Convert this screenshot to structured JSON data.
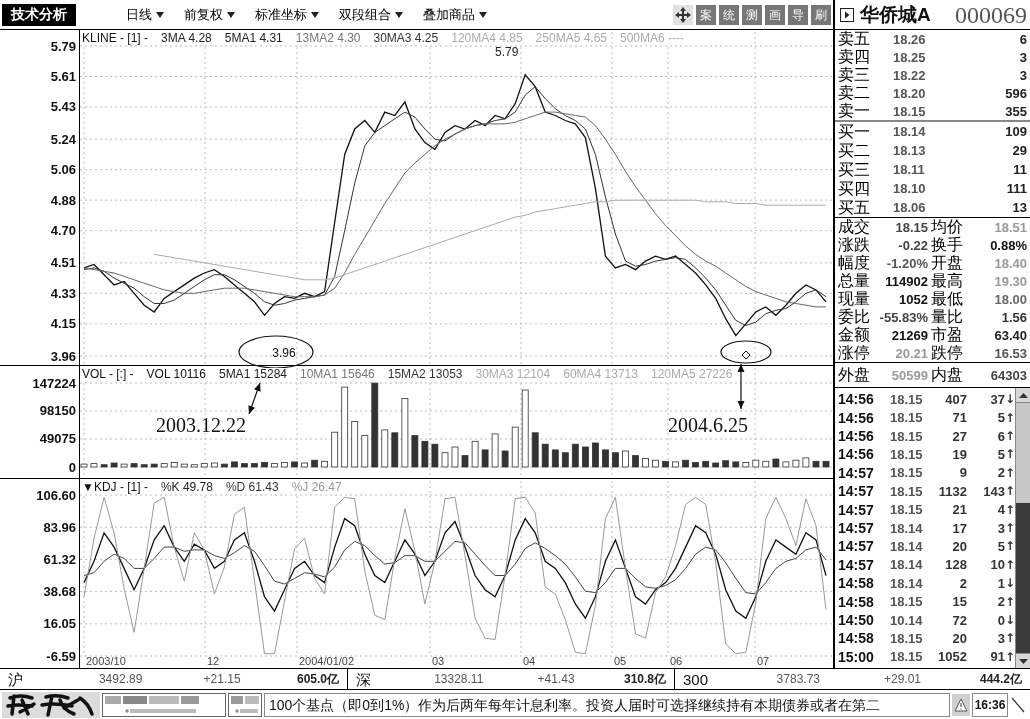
{
  "toolbar": {
    "title": "技术分析",
    "menus": [
      "日线",
      "前复权",
      "标准坐标",
      "双段组合",
      "叠加商品"
    ],
    "tools": [
      "案",
      "统",
      "测",
      "画",
      "导",
      "刷"
    ]
  },
  "quote_header": {
    "name": "华侨城A",
    "code": "000069"
  },
  "price_panel": {
    "legend": [
      {
        "text": "KLINE - [1] -",
        "color": "#111111"
      },
      {
        "text": "3MA 4.28",
        "color": "#222222"
      },
      {
        "text": "5MA1 4.31",
        "color": "#222222"
      },
      {
        "text": "13MA2 4.30",
        "color": "#777777"
      },
      {
        "text": "30MA3 4.25",
        "color": "#333333"
      },
      {
        "text": "120MA4 4.85",
        "color": "#aaaaaa"
      },
      {
        "text": "250MA5 4.65",
        "color": "#aaaaaa"
      },
      {
        "text": "500MA6 ----",
        "color": "#aaaaaa"
      }
    ],
    "chart_data": {
      "type": "line",
      "grid": true,
      "ylim": [
        3.96,
        5.79
      ],
      "yticks": [
        5.79,
        5.61,
        5.43,
        5.24,
        5.06,
        4.88,
        {
          "value": 4.7,
          "label": "4.70"
        },
        4.51,
        4.33,
        4.15,
        3.96
      ],
      "series": [
        {
          "color": "#111111",
          "values": [
            4.48,
            4.5,
            4.44,
            4.38,
            4.4,
            4.33,
            4.26,
            4.22,
            4.3,
            4.34,
            4.38,
            4.42,
            4.45,
            4.47,
            4.43,
            4.38,
            4.33,
            4.28,
            4.2,
            4.27,
            4.31,
            4.3,
            4.33,
            4.31,
            4.34,
            4.75,
            5.15,
            5.3,
            5.35,
            5.28,
            5.4,
            5.38,
            5.46,
            5.3,
            5.22,
            5.18,
            5.28,
            5.32,
            5.3,
            5.35,
            5.32,
            5.38,
            5.36,
            5.45,
            5.62,
            5.55,
            5.4,
            5.38,
            5.35,
            5.33,
            5.25,
            4.95,
            4.55,
            4.48,
            4.5,
            4.47,
            4.52,
            4.55,
            4.53,
            4.55,
            4.5,
            4.45,
            4.38,
            4.3,
            4.18,
            4.08,
            4.15,
            4.22,
            4.25,
            4.2,
            4.26,
            4.33,
            4.38,
            4.35,
            4.28
          ]
        },
        {
          "color": "#333333",
          "values": [
            4.47,
            4.48,
            4.46,
            4.42,
            4.39,
            4.36,
            4.31,
            4.27,
            4.27,
            4.29,
            4.33,
            4.37,
            4.41,
            4.44,
            4.44,
            4.41,
            4.37,
            4.33,
            4.28,
            4.26,
            4.27,
            4.29,
            4.3,
            4.31,
            4.32,
            4.43,
            4.7,
            4.98,
            5.2,
            5.28,
            5.32,
            5.36,
            5.4,
            5.37,
            5.3,
            5.24,
            5.23,
            5.27,
            5.3,
            5.32,
            5.33,
            5.35,
            5.36,
            5.4,
            5.5,
            5.55,
            5.48,
            5.42,
            5.38,
            5.35,
            5.3,
            5.15,
            4.9,
            4.68,
            4.52,
            4.49,
            4.5,
            4.52,
            4.53,
            4.54,
            4.53,
            4.48,
            4.42,
            4.35,
            4.26,
            4.17,
            4.14,
            4.16,
            4.21,
            4.23,
            4.24,
            4.28,
            4.33,
            4.35,
            4.31
          ]
        },
        {
          "color": "#666666",
          "values": [
            4.48,
            4.47,
            4.46,
            4.45,
            4.43,
            4.41,
            4.39,
            4.37,
            4.35,
            4.34,
            4.33,
            4.33,
            4.34,
            4.35,
            4.36,
            4.36,
            4.36,
            4.35,
            4.34,
            4.33,
            4.32,
            4.31,
            4.31,
            4.31,
            4.32,
            4.36,
            4.45,
            4.56,
            4.66,
            4.76,
            4.86,
            4.95,
            5.04,
            5.1,
            5.15,
            5.2,
            5.24,
            5.27,
            5.3,
            5.32,
            5.33,
            5.33,
            5.33,
            5.34,
            5.36,
            5.38,
            5.4,
            5.4,
            5.39,
            5.38,
            5.37,
            5.32,
            5.24,
            5.15,
            5.05,
            4.96,
            4.88,
            4.8,
            4.73,
            4.67,
            4.61,
            4.56,
            4.52,
            4.49,
            4.45,
            4.41,
            4.37,
            4.34,
            4.32,
            4.3,
            4.28,
            4.27,
            4.26,
            4.25,
            4.25
          ]
        },
        {
          "color": "#aaaaaa",
          "values": [
            null,
            null,
            null,
            null,
            null,
            null,
            null,
            4.56,
            4.55,
            4.54,
            4.53,
            4.52,
            4.51,
            4.5,
            4.49,
            4.48,
            4.47,
            4.46,
            4.45,
            4.44,
            4.43,
            4.42,
            4.41,
            4.41,
            4.41,
            4.42,
            4.44,
            4.46,
            4.48,
            4.5,
            4.52,
            4.54,
            4.56,
            4.58,
            4.6,
            4.62,
            4.64,
            4.66,
            4.68,
            4.7,
            4.72,
            4.74,
            4.76,
            4.78,
            4.79,
            4.81,
            4.82,
            4.83,
            4.84,
            4.85,
            4.86,
            4.87,
            4.87,
            4.88,
            4.88,
            4.88,
            4.88,
            4.88,
            4.88,
            4.88,
            4.88,
            4.88,
            4.87,
            4.87,
            4.87,
            4.86,
            4.86,
            4.86,
            4.85,
            4.85,
            4.85,
            4.85,
            4.85,
            4.85,
            4.85
          ]
        }
      ]
    },
    "peak_label": "5.79",
    "callouts": [
      {
        "kind": "text",
        "text": "3.96",
        "date": "2003.12.22"
      },
      {
        "kind": "marker",
        "date": "2004.6.25"
      }
    ]
  },
  "volume_panel": {
    "legend": [
      {
        "text": "VOL - [:] -",
        "color": "#111111"
      },
      {
        "text": "VOL 10116",
        "color": "#111111"
      },
      {
        "text": "5MA1 15284",
        "color": "#222222"
      },
      {
        "text": "10MA1 15646",
        "color": "#777777"
      },
      {
        "text": "15MA2 13053",
        "color": "#333333"
      },
      {
        "text": "30MA3 12104",
        "color": "#aaaaaa"
      },
      {
        "text": "60MA4 13713",
        "color": "#aaaaaa"
      },
      {
        "text": "120MA5 27226",
        "color": "#aaaaaa"
      }
    ],
    "chart_data": {
      "type": "bar",
      "grid": true,
      "ylim": [
        0,
        147224
      ],
      "yticks": [
        147224,
        98150,
        49075,
        0
      ],
      "values": [
        5000,
        6000,
        4000,
        7000,
        5000,
        6000,
        4000,
        5000,
        6000,
        8000,
        5000,
        4000,
        6000,
        7000,
        5000,
        9000,
        6000,
        6000,
        8000,
        6000,
        8000,
        9000,
        7000,
        12000,
        10000,
        61000,
        140000,
        80000,
        55000,
        147000,
        65000,
        60000,
        120000,
        55000,
        45000,
        40000,
        25000,
        35000,
        20000,
        45000,
        30000,
        58000,
        28000,
        70000,
        135000,
        60000,
        40000,
        30000,
        25000,
        40000,
        35000,
        42000,
        30000,
        25000,
        28000,
        20000,
        15000,
        12000,
        10000,
        9000,
        12000,
        8000,
        10000,
        7000,
        11000,
        9000,
        8000,
        12000,
        10000,
        14000,
        9000,
        12000,
        16000,
        10000,
        10000
      ]
    }
  },
  "kdj_panel": {
    "legend": [
      {
        "text": "▼KDJ - [1] -",
        "color": "#111111"
      },
      {
        "text": "%K 49.78",
        "color": "#222222"
      },
      {
        "text": "%D 61.43",
        "color": "#333333"
      },
      {
        "text": "%J 26.47",
        "color": "#999999"
      }
    ],
    "chart_data": {
      "type": "line",
      "grid": true,
      "ylim": [
        -6.59,
        106.6
      ],
      "yticks": [
        {
          "value": 106.6,
          "label": "106.60"
        },
        83.96,
        61.32,
        38.68,
        16.05,
        -6.59
      ],
      "series": [
        {
          "color": "#111111",
          "values": [
            45,
            60,
            80,
            70,
            55,
            40,
            55,
            75,
            85,
            70,
            60,
            72,
            68,
            55,
            60,
            75,
            80,
            60,
            35,
            25,
            40,
            55,
            60,
            50,
            45,
            70,
            90,
            85,
            65,
            50,
            45,
            60,
            75,
            65,
            50,
            60,
            80,
            88,
            70,
            50,
            40,
            35,
            50,
            75,
            90,
            80,
            60,
            55,
            45,
            30,
            20,
            35,
            60,
            75,
            55,
            35,
            30,
            40,
            45,
            55,
            70,
            85,
            80,
            65,
            40,
            25,
            20,
            35,
            60,
            75,
            70,
            65,
            80,
            75,
            50
          ]
        },
        {
          "color": "#444444",
          "values": [
            50,
            52,
            60,
            65,
            62,
            55,
            55,
            62,
            70,
            70,
            67,
            68,
            68,
            64,
            62,
            66,
            71,
            67,
            57,
            46,
            44,
            48,
            52,
            51,
            49,
            56,
            68,
            74,
            71,
            64,
            58,
            59,
            64,
            64,
            60,
            60,
            67,
            74,
            73,
            65,
            57,
            50,
            50,
            58,
            69,
            73,
            69,
            64,
            58,
            49,
            39,
            38,
            45,
            55,
            55,
            48,
            42,
            41,
            43,
            47,
            55,
            65,
            70,
            68,
            59,
            48,
            38,
            37,
            45,
            55,
            60,
            62,
            68,
            70,
            61
          ]
        },
        {
          "color": "#999999",
          "values": [
            35,
            76,
            105,
            80,
            41,
            10,
            55,
            101,
            105,
            70,
            46,
            80,
            68,
            37,
            56,
            93,
            98,
            46,
            -5,
            -5,
            32,
            69,
            76,
            48,
            37,
            98,
            105,
            104,
            53,
            22,
            19,
            62,
            97,
            67,
            30,
            60,
            104,
            105,
            64,
            20,
            6,
            5,
            50,
            104,
            105,
            94,
            42,
            37,
            19,
            -4,
            -5,
            29,
            90,
            105,
            55,
            9,
            6,
            38,
            49,
            71,
            100,
            105,
            100,
            59,
            2,
            -5,
            -4,
            31,
            90,
            105,
            90,
            71,
            104,
            85,
            26
          ]
        }
      ]
    }
  },
  "date_axis": [
    "2003/10",
    "12",
    "2004/01/02",
    "03",
    "04",
    "05",
    "06",
    "07"
  ],
  "order_book": {
    "asks": [
      {
        "label": "卖五",
        "price": "18.26",
        "volume": "6"
      },
      {
        "label": "卖四",
        "price": "18.25",
        "volume": "3"
      },
      {
        "label": "卖三",
        "price": "18.22",
        "volume": "3"
      },
      {
        "label": "卖二",
        "price": "18.20",
        "volume": "596"
      },
      {
        "label": "卖一",
        "price": "18.15",
        "volume": "355"
      }
    ],
    "bids": [
      {
        "label": "买一",
        "price": "18.14",
        "volume": "109"
      },
      {
        "label": "买二",
        "price": "18.13",
        "volume": "29"
      },
      {
        "label": "买三",
        "price": "18.11",
        "volume": "11"
      },
      {
        "label": "买四",
        "price": "18.10",
        "volume": "111"
      },
      {
        "label": "买五",
        "price": "18.06",
        "volume": "13"
      }
    ]
  },
  "stats": [
    {
      "left": {
        "label": "成交",
        "value": "18.15",
        "color": "#444444"
      },
      "right": {
        "label": "均价",
        "value": "18.51",
        "color": "#999999"
      }
    },
    {
      "left": {
        "label": "涨跌",
        "value": "-0.22",
        "color": "#444444"
      },
      "right": {
        "label": "换手",
        "value": "0.88%",
        "color": "#111111"
      }
    },
    {
      "left": {
        "label": "幅度",
        "value": "-1.20%",
        "color": "#555555"
      },
      "right": {
        "label": "开盘",
        "value": "18.40",
        "color": "#999999"
      }
    },
    {
      "left": {
        "label": "总量",
        "value": "114902",
        "color": "#111111"
      },
      "right": {
        "label": "最高",
        "value": "19.30",
        "color": "#999999"
      }
    },
    {
      "left": {
        "label": "现量",
        "value": "1052",
        "color": "#111111"
      },
      "right": {
        "label": "最低",
        "value": "18.00",
        "color": "#666666"
      }
    },
    {
      "left": {
        "label": "委比",
        "value": "-55.83%",
        "color": "#444444"
      },
      "right": {
        "label": "量比",
        "value": "1.56",
        "color": "#333333"
      }
    },
    {
      "left": {
        "label": "金额",
        "value": "21269",
        "color": "#111111"
      },
      "right": {
        "label": "市盈",
        "value": "63.40",
        "color": "#222222"
      }
    },
    {
      "left": {
        "label": "涨停",
        "value": "20.21",
        "color": "#999999"
      },
      "right": {
        "label": "跌停",
        "value": "16.53",
        "color": "#555555"
      }
    }
  ],
  "trade_split": {
    "left": {
      "label": "外盘",
      "value": "50599",
      "color": "#999999"
    },
    "right": {
      "label": "内盘",
      "value": "64303",
      "color": "#444444"
    }
  },
  "ticks": [
    {
      "time": "14:56",
      "price": "18.15",
      "volume": "407",
      "count": "37",
      "arrow": "↓"
    },
    {
      "time": "14:56",
      "price": "18.15",
      "volume": "71",
      "count": "5",
      "arrow": "↑"
    },
    {
      "time": "14:56",
      "price": "18.15",
      "volume": "27",
      "count": "6",
      "arrow": "↑"
    },
    {
      "time": "14:56",
      "price": "18.15",
      "volume": "19",
      "count": "5",
      "arrow": "↑"
    },
    {
      "time": "14:57",
      "price": "18.15",
      "volume": "9",
      "count": "2",
      "arrow": "↑"
    },
    {
      "time": "14:57",
      "price": "18.15",
      "volume": "1132",
      "count": "143",
      "arrow": "↑"
    },
    {
      "time": "14:57",
      "price": "18.15",
      "volume": "21",
      "count": "4",
      "arrow": "↑"
    },
    {
      "time": "14:57",
      "price": "18.14",
      "volume": "17",
      "count": "3",
      "arrow": "↑"
    },
    {
      "time": "14:57",
      "price": "18.14",
      "volume": "20",
      "count": "5",
      "arrow": "↑"
    },
    {
      "time": "14:57",
      "price": "18.14",
      "volume": "128",
      "count": "10",
      "arrow": "↑"
    },
    {
      "time": "14:58",
      "price": "18.14",
      "volume": "2",
      "count": "1",
      "arrow": "↓"
    },
    {
      "time": "14:58",
      "price": "18.15",
      "volume": "15",
      "count": "2",
      "arrow": "↑"
    },
    {
      "time": "14:50",
      "price": "10.14",
      "volume": "72",
      "count": "0",
      "arrow": "↓"
    },
    {
      "time": "14:58",
      "price": "18.15",
      "volume": "20",
      "count": "3",
      "arrow": "↑"
    },
    {
      "time": "15:00",
      "price": "18.15",
      "volume": "1052",
      "count": "91",
      "arrow": "↑"
    }
  ],
  "index_row": [
    {
      "name": "沪",
      "value": "3492.89",
      "change": "+21.15",
      "amount": "605.0亿"
    },
    {
      "name": "深",
      "value": "13328.11",
      "change": "+41.43",
      "amount": "310.8亿"
    },
    {
      "name": "300",
      "value": "3783.73",
      "change": "+29.01",
      "amount": "444.2亿"
    }
  ],
  "news_ticker": "100个基点（即0到1%）作为后两年每年计息利率。投资人届时可选择继续持有本期债券或者在第二",
  "clock": "16:36"
}
